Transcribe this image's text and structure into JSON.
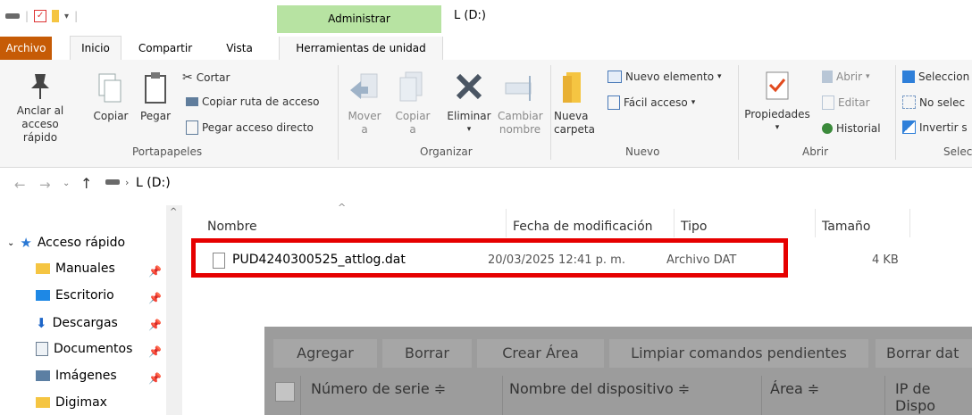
{
  "window": {
    "title": "L (D:)",
    "context_tab": "Administrar"
  },
  "tabs": {
    "archivo": "Archivo",
    "inicio": "Inicio",
    "compartir": "Compartir",
    "vista": "Vista",
    "herramientas": "Herramientas de unidad"
  },
  "ribbon": {
    "portapapeles": {
      "group": "Portapapeles",
      "anclar": "Anclar al acceso rápido",
      "copiar": "Copiar",
      "pegar": "Pegar",
      "cortar": "Cortar",
      "copiar_ruta": "Copiar ruta de acceso",
      "pegar_acceso": "Pegar acceso directo"
    },
    "organizar": {
      "group": "Organizar",
      "mover": "Mover a",
      "copiar_a": "Copiar a",
      "eliminar": "Eliminar",
      "cambiar": "Cambiar nombre"
    },
    "nuevo": {
      "group": "Nuevo",
      "nueva_carpeta": "Nueva carpeta",
      "nuevo_elemento": "Nuevo elemento",
      "facil_acceso": "Fácil acceso"
    },
    "abrir": {
      "group": "Abrir",
      "propiedades": "Propiedades",
      "abrir": "Abrir",
      "editar": "Editar",
      "historial": "Historial"
    },
    "seleccionar": {
      "group": "Selec",
      "seleccionar_todo": "Seleccion",
      "no_seleccionar": "No selec",
      "invertir": "Invertir s"
    }
  },
  "address": {
    "path": "L (D:)"
  },
  "nav": {
    "acceso_rapido": "Acceso rápido",
    "items": [
      {
        "label": "Manuales",
        "icon": "folder-icon"
      },
      {
        "label": "Escritorio",
        "icon": "desktop-icon"
      },
      {
        "label": "Descargas",
        "icon": "download-icon"
      },
      {
        "label": "Documentos",
        "icon": "documents-icon"
      },
      {
        "label": "Imágenes",
        "icon": "pictures-icon"
      },
      {
        "label": "Digimax",
        "icon": "folder-icon"
      }
    ]
  },
  "filelist": {
    "columns": {
      "nombre": "Nombre",
      "fecha": "Fecha de modificación",
      "tipo": "Tipo",
      "tamano": "Tamaño"
    },
    "rows": [
      {
        "name": "PUD4240300525_attlog.dat",
        "date": "20/03/2025 12:41 p. m.",
        "type": "Archivo DAT",
        "size": "4 KB"
      }
    ]
  },
  "overlay": {
    "buttons": {
      "agregar": "Agregar",
      "borrar": "Borrar",
      "crear_area": "Crear Área",
      "limpiar": "Limpiar comandos pendientes",
      "borrar_dat": "Borrar dat"
    },
    "columns": {
      "serie": "Número de serie ≑",
      "dispositivo": "Nombre del dispositivo ≑",
      "area": "Área ≑",
      "ip": "IP de Dispo"
    }
  },
  "colors": {
    "archivo_tab": "#c65b06",
    "context_tab": "#b7e3a2",
    "highlight": "#e60000"
  }
}
